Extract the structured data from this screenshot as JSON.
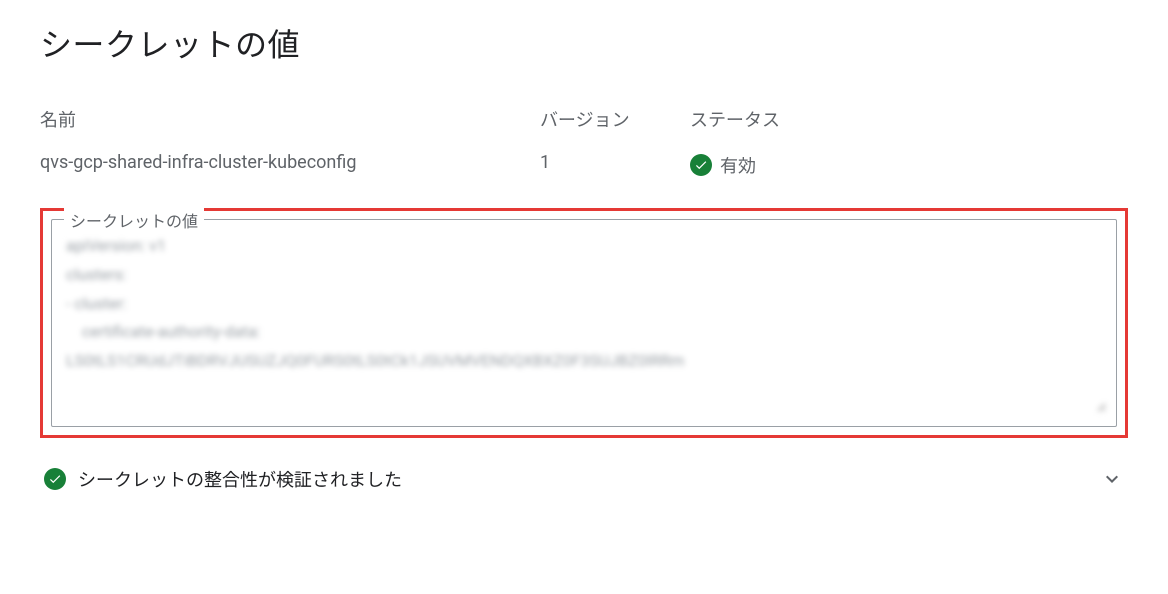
{
  "title": "シークレットの値",
  "meta": {
    "name_label": "名前",
    "name_value": "qvs-gcp-shared-infra-cluster-kubeconfig",
    "version_label": "バージョン",
    "version_value": "1",
    "status_label": "ステータス",
    "status_value": "有効"
  },
  "secret": {
    "fieldset_label": "シークレットの値",
    "value": "apiVersion: v1\nclusters:\n- cluster:\n    certificate-authority-data:\nLS0tLS1CRUdJTiBDRVJUSUZJQ0FURS0tLS0tCk1JSUVMVENDQXBXZ0F3SUJBZ0lRRm"
  },
  "integrity": {
    "text": "シークレットの整合性が検証されました"
  },
  "colors": {
    "success": "#188038",
    "highlight": "#e53935",
    "text_secondary": "#5f6368"
  }
}
